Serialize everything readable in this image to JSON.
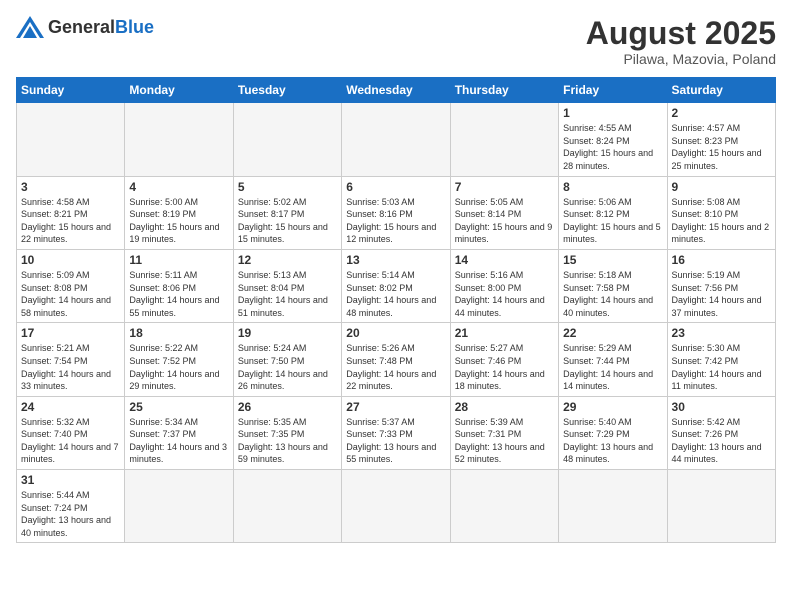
{
  "header": {
    "logo_general": "General",
    "logo_blue": "Blue",
    "month_title": "August 2025",
    "subtitle": "Pilawa, Mazovia, Poland"
  },
  "calendar": {
    "days_of_week": [
      "Sunday",
      "Monday",
      "Tuesday",
      "Wednesday",
      "Thursday",
      "Friday",
      "Saturday"
    ],
    "weeks": [
      [
        {
          "day": "",
          "info": ""
        },
        {
          "day": "",
          "info": ""
        },
        {
          "day": "",
          "info": ""
        },
        {
          "day": "",
          "info": ""
        },
        {
          "day": "",
          "info": ""
        },
        {
          "day": "1",
          "info": "Sunrise: 4:55 AM\nSunset: 8:24 PM\nDaylight: 15 hours\nand 28 minutes."
        },
        {
          "day": "2",
          "info": "Sunrise: 4:57 AM\nSunset: 8:23 PM\nDaylight: 15 hours\nand 25 minutes."
        }
      ],
      [
        {
          "day": "3",
          "info": "Sunrise: 4:58 AM\nSunset: 8:21 PM\nDaylight: 15 hours\nand 22 minutes."
        },
        {
          "day": "4",
          "info": "Sunrise: 5:00 AM\nSunset: 8:19 PM\nDaylight: 15 hours\nand 19 minutes."
        },
        {
          "day": "5",
          "info": "Sunrise: 5:02 AM\nSunset: 8:17 PM\nDaylight: 15 hours\nand 15 minutes."
        },
        {
          "day": "6",
          "info": "Sunrise: 5:03 AM\nSunset: 8:16 PM\nDaylight: 15 hours\nand 12 minutes."
        },
        {
          "day": "7",
          "info": "Sunrise: 5:05 AM\nSunset: 8:14 PM\nDaylight: 15 hours\nand 9 minutes."
        },
        {
          "day": "8",
          "info": "Sunrise: 5:06 AM\nSunset: 8:12 PM\nDaylight: 15 hours\nand 5 minutes."
        },
        {
          "day": "9",
          "info": "Sunrise: 5:08 AM\nSunset: 8:10 PM\nDaylight: 15 hours\nand 2 minutes."
        }
      ],
      [
        {
          "day": "10",
          "info": "Sunrise: 5:09 AM\nSunset: 8:08 PM\nDaylight: 14 hours\nand 58 minutes."
        },
        {
          "day": "11",
          "info": "Sunrise: 5:11 AM\nSunset: 8:06 PM\nDaylight: 14 hours\nand 55 minutes."
        },
        {
          "day": "12",
          "info": "Sunrise: 5:13 AM\nSunset: 8:04 PM\nDaylight: 14 hours\nand 51 minutes."
        },
        {
          "day": "13",
          "info": "Sunrise: 5:14 AM\nSunset: 8:02 PM\nDaylight: 14 hours\nand 48 minutes."
        },
        {
          "day": "14",
          "info": "Sunrise: 5:16 AM\nSunset: 8:00 PM\nDaylight: 14 hours\nand 44 minutes."
        },
        {
          "day": "15",
          "info": "Sunrise: 5:18 AM\nSunset: 7:58 PM\nDaylight: 14 hours\nand 40 minutes."
        },
        {
          "day": "16",
          "info": "Sunrise: 5:19 AM\nSunset: 7:56 PM\nDaylight: 14 hours\nand 37 minutes."
        }
      ],
      [
        {
          "day": "17",
          "info": "Sunrise: 5:21 AM\nSunset: 7:54 PM\nDaylight: 14 hours\nand 33 minutes."
        },
        {
          "day": "18",
          "info": "Sunrise: 5:22 AM\nSunset: 7:52 PM\nDaylight: 14 hours\nand 29 minutes."
        },
        {
          "day": "19",
          "info": "Sunrise: 5:24 AM\nSunset: 7:50 PM\nDaylight: 14 hours\nand 26 minutes."
        },
        {
          "day": "20",
          "info": "Sunrise: 5:26 AM\nSunset: 7:48 PM\nDaylight: 14 hours\nand 22 minutes."
        },
        {
          "day": "21",
          "info": "Sunrise: 5:27 AM\nSunset: 7:46 PM\nDaylight: 14 hours\nand 18 minutes."
        },
        {
          "day": "22",
          "info": "Sunrise: 5:29 AM\nSunset: 7:44 PM\nDaylight: 14 hours\nand 14 minutes."
        },
        {
          "day": "23",
          "info": "Sunrise: 5:30 AM\nSunset: 7:42 PM\nDaylight: 14 hours\nand 11 minutes."
        }
      ],
      [
        {
          "day": "24",
          "info": "Sunrise: 5:32 AM\nSunset: 7:40 PM\nDaylight: 14 hours\nand 7 minutes."
        },
        {
          "day": "25",
          "info": "Sunrise: 5:34 AM\nSunset: 7:37 PM\nDaylight: 14 hours\nand 3 minutes."
        },
        {
          "day": "26",
          "info": "Sunrise: 5:35 AM\nSunset: 7:35 PM\nDaylight: 13 hours\nand 59 minutes."
        },
        {
          "day": "27",
          "info": "Sunrise: 5:37 AM\nSunset: 7:33 PM\nDaylight: 13 hours\nand 55 minutes."
        },
        {
          "day": "28",
          "info": "Sunrise: 5:39 AM\nSunset: 7:31 PM\nDaylight: 13 hours\nand 52 minutes."
        },
        {
          "day": "29",
          "info": "Sunrise: 5:40 AM\nSunset: 7:29 PM\nDaylight: 13 hours\nand 48 minutes."
        },
        {
          "day": "30",
          "info": "Sunrise: 5:42 AM\nSunset: 7:26 PM\nDaylight: 13 hours\nand 44 minutes."
        }
      ],
      [
        {
          "day": "31",
          "info": "Sunrise: 5:44 AM\nSunset: 7:24 PM\nDaylight: 13 hours\nand 40 minutes."
        },
        {
          "day": "",
          "info": ""
        },
        {
          "day": "",
          "info": ""
        },
        {
          "day": "",
          "info": ""
        },
        {
          "day": "",
          "info": ""
        },
        {
          "day": "",
          "info": ""
        },
        {
          "day": "",
          "info": ""
        }
      ]
    ]
  }
}
